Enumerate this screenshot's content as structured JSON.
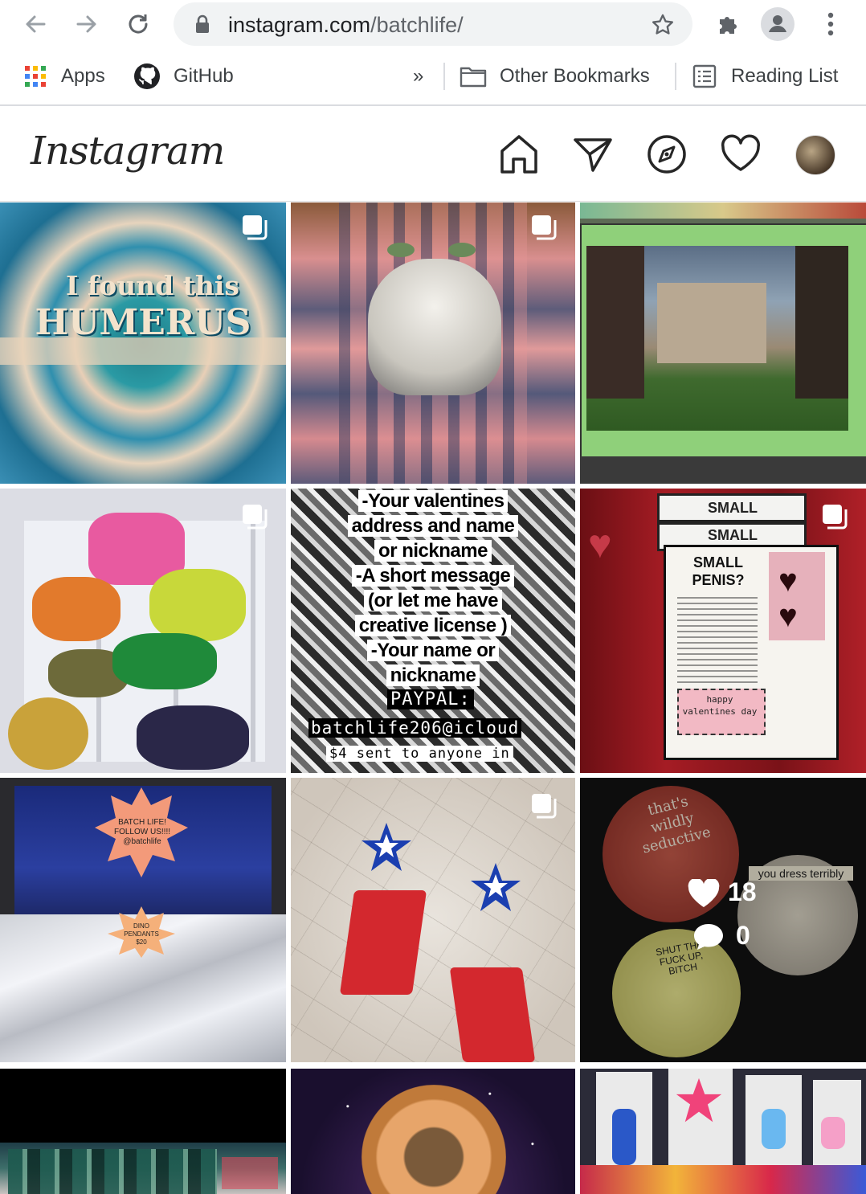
{
  "browser": {
    "url_domain": "instagram.com",
    "url_path": "/batchlife/",
    "bookmarks": {
      "apps": "Apps",
      "github": "GitHub",
      "overflow": "»",
      "other": "Other Bookmarks",
      "reading_list": "Reading List"
    }
  },
  "instagram": {
    "logo": "Instagram"
  },
  "posts": {
    "p1": {
      "line1": "I found this",
      "line2": "HUMERUS"
    },
    "p5": {
      "lines": [
        "-Your valentines",
        "address and name",
        "or nickname",
        "-A short message",
        "(or let me have",
        "creative license )",
        "-Your name or",
        "nickname"
      ],
      "paypal_label": "PAYPAL:",
      "email": "batchlife206@icloud",
      "price_line": "$4 sent to anyone in"
    },
    "p6": {
      "small1": "SMALL",
      "small2": "SMALL",
      "main": "SMALL PENIS?",
      "sub": "happy valentines day"
    },
    "p7": {
      "sign1": "BATCH LIFE! FOLLOW US!!!! @batchlife",
      "sign2": "DINO PENDANTS $20"
    },
    "p9": {
      "likes": "18",
      "comments": "0",
      "button1": "that's wildly seductive",
      "button2": "you dress terribly",
      "button3": "SHUT THE FUCK UP, BITCH"
    }
  },
  "colors": {
    "chrome_bg": "#ffffff",
    "omnibox_bg": "#f1f3f4",
    "ig_text": "#262626",
    "border": "#dbdbdb"
  }
}
